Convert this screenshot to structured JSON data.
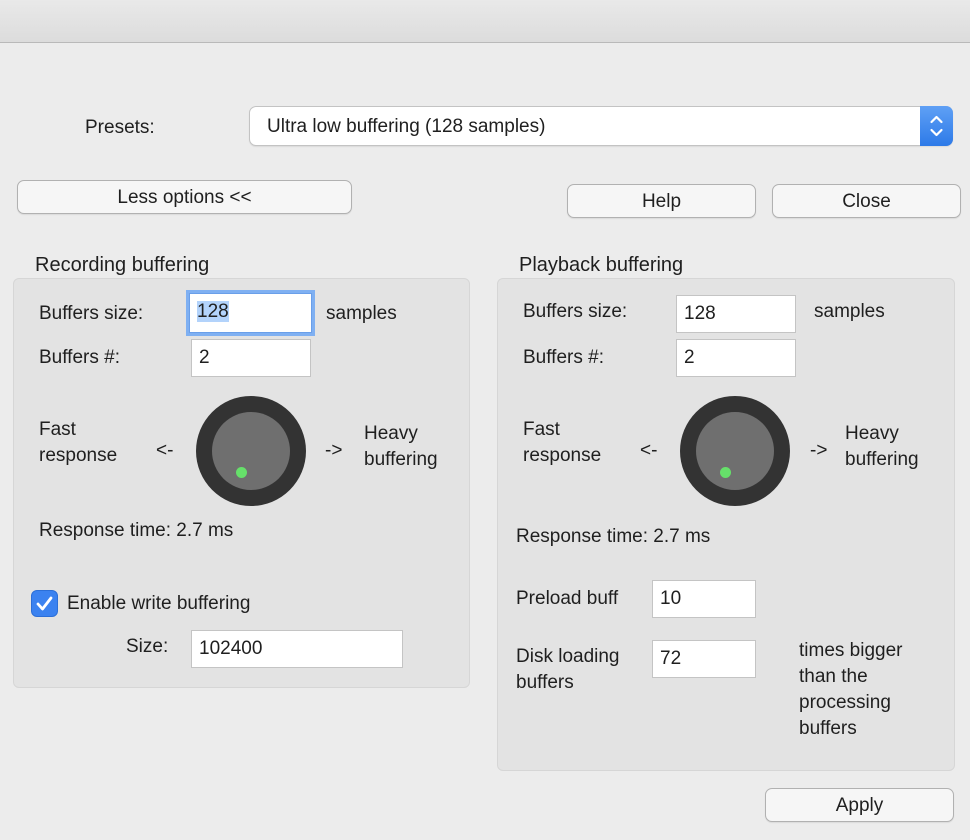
{
  "presets": {
    "label": "Presets:",
    "value": "Ultra low buffering (128 samples)"
  },
  "buttons": {
    "less_options": "Less options <<",
    "help": "Help",
    "close": "Close",
    "apply": "Apply"
  },
  "recording": {
    "title": "Recording buffering",
    "buffers_size_label": "Buffers size:",
    "buffers_size_value": "128",
    "samples_label": "samples",
    "buffers_count_label": "Buffers #:",
    "buffers_count_value": "2",
    "fast_label_1": "Fast",
    "fast_label_2": "response",
    "left_arrow": "<-",
    "right_arrow": "->",
    "heavy_label_1": "Heavy",
    "heavy_label_2": "buffering",
    "response_time": "Response time: 2.7 ms",
    "enable_write_label": "Enable write buffering",
    "enable_write_checked": true,
    "size_label": "Size:",
    "size_value": "102400"
  },
  "playback": {
    "title": "Playback buffering",
    "buffers_size_label": "Buffers size:",
    "buffers_size_value": "128",
    "samples_label": "samples",
    "buffers_count_label": "Buffers #:",
    "buffers_count_value": "2",
    "fast_label_1": "Fast",
    "fast_label_2": "response",
    "left_arrow": "<-",
    "right_arrow": "->",
    "heavy_label_1": "Heavy",
    "heavy_label_2": "buffering",
    "response_time": "Response time: 2.7 ms",
    "preload_label": "Preload buff",
    "preload_value": "10",
    "disk_loading_label_1": "Disk loading",
    "disk_loading_label_2": "buffers",
    "disk_loading_value": "72",
    "times_bigger_1": "times bigger",
    "times_bigger_2": "than the",
    "times_bigger_3": "processing",
    "times_bigger_4": "buffers"
  },
  "colors": {
    "accent": "#3b82f0",
    "knob_dot": "#66e06a",
    "focus_ring": "#7fb0f2"
  },
  "icons": {
    "select_arrows": "chevron-up-down-icon",
    "checkbox": "checkmark-icon"
  }
}
